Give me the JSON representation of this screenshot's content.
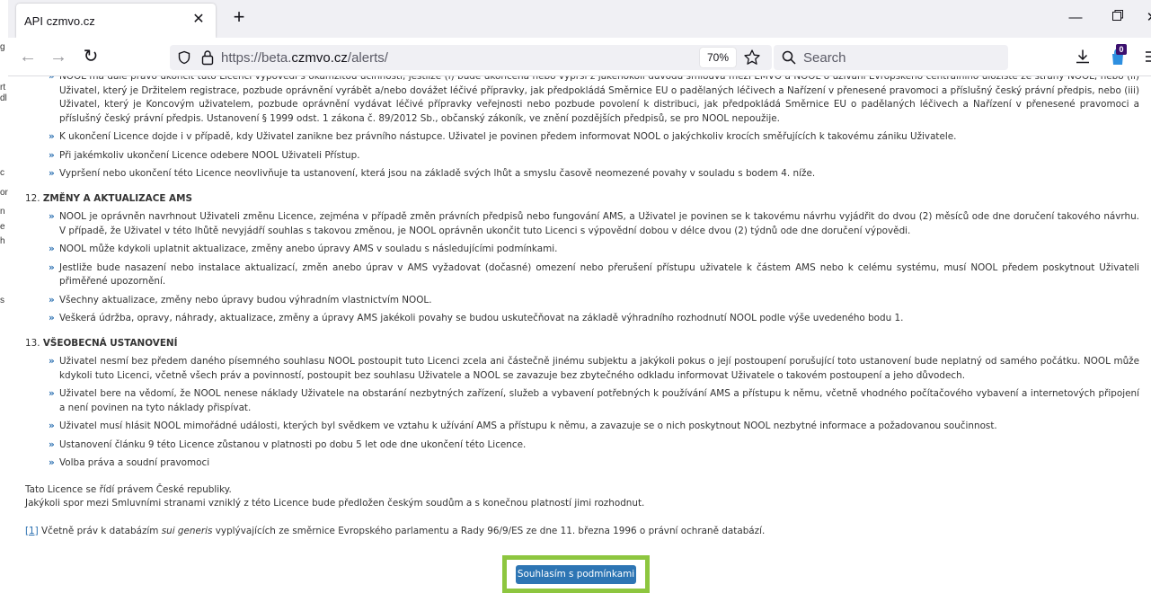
{
  "browser": {
    "tab_title": "API czmvo.cz",
    "url_prefix": "https://beta.",
    "url_domain": "czmvo.cz",
    "url_suffix": "/alerts/",
    "zoom": "70%",
    "search_placeholder": "Search",
    "extension_badge": "0"
  },
  "background_window": {
    "fragments": [
      "rt",
      "dl",
      "c",
      "or",
      "n",
      "e",
      "h",
      "s",
      "g"
    ]
  },
  "document": {
    "top_partial": "NOOL má dále právo ukončit tuto Licenci výpovědí s okamžitou účinností, jestliže (i) bude ukončena nebo vyprší z jakéhokoli důvodu smlouva mezi EMVO a NOOL o užívání Evropského centrálního úložiště ze strany NOOL, nebo (ii) Uživatel, který je Držitelem registrace, pozbude oprávnění vyrábět a/nebo dovážet léčivé přípravky, jak předpokládá Směrnice EU o padělaných léčivech a Nařízení v přenesené pravomoci a příslušný český právní předpis, nebo (iii) Uživatel, který je Koncovým uživatelem, pozbude oprávnění vydávat léčivé přípravky veřejnosti nebo pozbude povolení k distribuci, jak předpokládá Směrnice EU o padělaných léčivech a Nařízení v přenesené pravomoci a příslušný český právní předpis. Ustanovení § 1999 odst. 1 zákona č. 89/2012 Sb., občanský zákoník, ve znění pozdějších předpisů, se pro NOOL nepoužije.",
    "bullets_a": [
      "K ukončení Licence dojde i v případě, kdy Uživatel zanikne bez právního nástupce. Uživatel je povinen předem informovat NOOL o jakýchkoliv krocích směřujících k takovému zániku Uživatele.",
      "Při jakémkoliv ukončení Licence odebere NOOL Uživateli Přístup.",
      "Vypršení nebo ukončení této Licence neovlivňuje ta ustanovení, která jsou na základě svých lhůt a smyslu časově neomezené povahy v souladu s bodem 4. níže."
    ],
    "section12_number": "12.",
    "section12_title": "ZMĚNY A AKTUALIZACE AMS",
    "bullets_12": [
      "NOOL je oprávněn navrhnout Uživateli změnu Licence, zejména v případě změn právních předpisů nebo fungování AMS, a Uživatel je povinen se k takovému návrhu vyjádřit do dvou (2) měsíců ode dne doručení takového návrhu. V případě, že Uživatel v této lhůtě nevyjádří souhlas s takovou změnou, je NOOL oprávněn ukončit tuto Licenci s výpovědní dobou v délce dvou (2) týdnů ode dne doručení výpovědi.",
      "NOOL může kdykoli uplatnit aktualizace, změny anebo úpravy AMS v souladu s následujícími podmínkami.",
      "Jestliže bude nasazení nebo instalace aktualizací, změn anebo úprav v AMS vyžadovat (dočasné) omezení nebo přerušení přístupu uživatele k částem AMS nebo k celému systému, musí NOOL předem poskytnout Uživateli přiměřené upozornění.",
      "Všechny aktualizace, změny nebo úpravy budou výhradním vlastnictvím NOOL.",
      "Veškerá údržba, opravy, náhrady, aktualizace, změny a úpravy AMS jakékoli povahy se budou uskutečňovat na základě výhradního rozhodnutí NOOL podle výše uvedeného bodu 1."
    ],
    "section13_number": "13.",
    "section13_title": "VŠEOBECNÁ USTANOVENÍ",
    "bullets_13": [
      "Uživatel nesmí bez předem daného písemného souhlasu NOOL postoupit tuto Licenci zcela ani částečně jinému subjektu a jakýkoli pokus o její postoupení porušující toto ustanovení bude neplatný od samého počátku. NOOL může kdykoli tuto Licenci, včetně všech práv a povinností, postoupit bez souhlasu Uživatele a NOOL se zavazuje bez zbytečného odkladu informovat Uživatele o takovém postoupení a jeho důvodech.",
      "Uživatel bere na vědomí, že NOOL nenese náklady Uživatele na obstarání nezbytných zařízení, služeb a vybavení potřebných k používání AMS a přístupu k němu, včetně vhodného počítačového vybavení a internetových připojení a není povinen na tyto náklady přispívat.",
      "Uživatel musí hlásit NOOL mimořádné události, kterých byl svědkem ve vztahu k užívání AMS a přístupu k němu, a zavazuje se o nich poskytnout NOOL nezbytné informace a požadovanou součinnost.",
      "Ustanovení článku 9 této Licence zůstanou v platnosti po dobu 5 let ode dne ukončení této Licence.",
      "Volba práva a soudní pravomoci"
    ],
    "closing_1": "Tato Licence se řídí právem České republiky.",
    "closing_2": "Jakýkoli spor mezi Smluvními stranami vzniklý z této Licence bude předložen českým soudům a s konečnou platností jimi rozhodnut.",
    "footnote_ref": "[1]",
    "footnote_pre": " Včetně práv k databázím ",
    "footnote_em": "sui generis",
    "footnote_post": " vyplývajících ze směrnice Evropského parlamentu a Rady 96/9/ES ze dne 11. března 1996 o právní ochraně databází.",
    "consent_button": "Souhlasím s podmínkami",
    "bullet_glyph": "»"
  }
}
